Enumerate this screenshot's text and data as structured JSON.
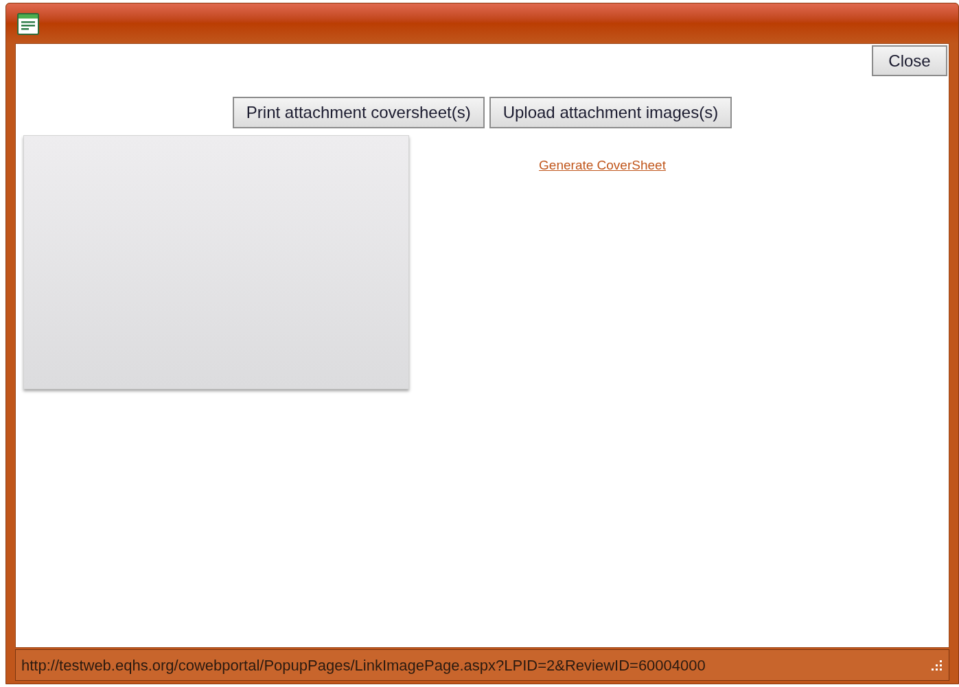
{
  "close_button": "Close",
  "buttons": [
    "Print attachment coversheet(s)",
    "Upload attachment images(s)"
  ],
  "link": "Generate CoverSheet",
  "status_bar": {
    "url": "http://testweb.eqhs.org/cowebportal/PopupPages/LinkImagePage.aspx?LPID=2&ReviewID=60004000"
  }
}
